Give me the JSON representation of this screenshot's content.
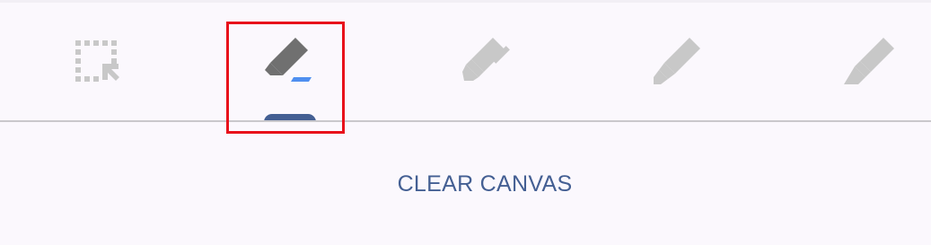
{
  "toolbar": {
    "tools": [
      {
        "name": "selection",
        "icon": "selection-icon",
        "state": "disabled"
      },
      {
        "name": "eraser",
        "icon": "eraser-icon",
        "state": "selected"
      },
      {
        "name": "pen",
        "icon": "pen-icon",
        "state": "disabled"
      },
      {
        "name": "pencil",
        "icon": "pencil-icon",
        "state": "disabled"
      },
      {
        "name": "highlighter",
        "icon": "highlighter-icon",
        "state": "disabled"
      }
    ],
    "selected_tool": "eraser"
  },
  "actions": {
    "clear_label": "CLEAR CANVAS"
  },
  "colors": {
    "background": "#fbf8fd",
    "active_icon": "#707070",
    "inactive_icon": "#c8c8c8",
    "accent": "#445f93",
    "eraser_accent": "#4f8ff0",
    "highlight_border": "#e8111b"
  }
}
